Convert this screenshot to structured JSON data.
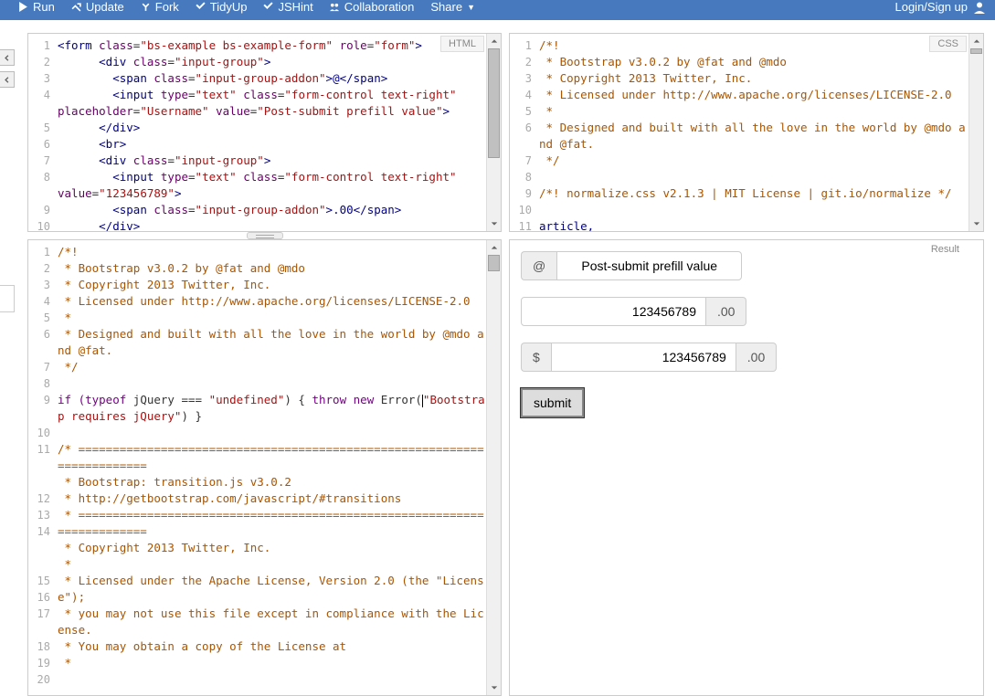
{
  "topbar": {
    "run": "Run",
    "update": "Update",
    "fork": "Fork",
    "tidyup": "TidyUp",
    "jshint": "JSHint",
    "collaboration": "Collaboration",
    "share": "Share",
    "login": "Login/Sign up"
  },
  "panels": {
    "html_label": "HTML",
    "css_label": "CSS",
    "result_label": "Result"
  },
  "html_gutter": [
    "1",
    "2",
    "3",
    "4",
    "5",
    "6",
    "7",
    "8",
    "9",
    "10"
  ],
  "css_gutter": [
    "1",
    "2",
    "3",
    "4",
    "5",
    "6",
    "7",
    "8",
    "9",
    "10",
    "11"
  ],
  "js_gutter": [
    "1",
    "2",
    "3",
    "4",
    "5",
    "6",
    "7",
    "8",
    "9",
    "10",
    "11",
    "12",
    "13",
    "14",
    "15",
    "16",
    "17",
    "18",
    "19",
    "20"
  ],
  "html_code": {
    "l1": {
      "a": "<form ",
      "b": "class",
      "c": "=",
      "d": "\"bs-example bs-example-form\"",
      "e": " role",
      "f": "=",
      "g": "\"form\"",
      "h": ">"
    },
    "l2": {
      "a": "      <div ",
      "b": "class",
      "c": "=",
      "d": "\"input-group\"",
      "e": ">"
    },
    "l3": {
      "a": "        <span ",
      "b": "class",
      "c": "=",
      "d": "\"input-group-addon\"",
      "e": ">@</span>"
    },
    "l4": {
      "a": "        <input ",
      "b": "type",
      "c": "=",
      "d": "\"text\"",
      "e": " class",
      "f": "=",
      "g": "\"form-control text-right\""
    },
    "l4b": {
      "a": "placeholder",
      "b": "=",
      "c": "\"Username\"",
      "d": " value",
      "e": "=",
      "f": "\"Post-submit prefill value\"",
      "g": ">"
    },
    "l5": {
      "a": "      </div>"
    },
    "l6": {
      "a": "      <br>"
    },
    "l7": {
      "a": "      <div ",
      "b": "class",
      "c": "=",
      "d": "\"input-group\"",
      "e": ">"
    },
    "l8": {
      "a": "        <input ",
      "b": "type",
      "c": "=",
      "d": "\"text\"",
      "e": " class",
      "f": "=",
      "g": "\"form-control text-right\""
    },
    "l8b": {
      "a": "value",
      "b": "=",
      "c": "\"123456789\"",
      "d": ">"
    },
    "l9": {
      "a": "        <span ",
      "b": "class",
      "c": "=",
      "d": "\"input-group-addon\"",
      "e": ">.00</span>"
    },
    "l10": {
      "a": "      </div>"
    }
  },
  "css_code": {
    "l1": "/*!",
    "l2": " * Bootstrap v3.0.2 by @fat and @mdo",
    "l3": " * Copyright 2013 Twitter, Inc.",
    "l4": " * Licensed under http://www.apache.org/licenses/LICENSE-2.0",
    "l5": " *",
    "l6": " * Designed and built with all the love in the world by @mdo and @fat.",
    "l7": " */",
    "l8": "",
    "l9": "/*! normalize.css v2.1.3 | MIT License | git.io/normalize */",
    "l10": "",
    "l11": "article,"
  },
  "js_code": {
    "l1": "/*!",
    "l2": " * Bootstrap v3.0.2 by @fat and @mdo",
    "l3": " * Copyright 2013 Twitter, Inc.",
    "l4": " * Licensed under http://www.apache.org/licenses/LICENSE-2.0",
    "l5": " *",
    "l6": " * Designed and built with all the love in the world by @mdo and @fat.",
    "l7": " */",
    "l8": "",
    "l9a": "if (",
    "l9b": "typeof",
    "l9c": " jQuery === ",
    "l9d": "\"undefined\"",
    "l9e": ") { ",
    "l9f": "throw",
    "l9g": " ",
    "l9h": "new",
    "l9i": " Error(",
    "l9j": "\"Bootstrap requires jQuery\"",
    "l9k": ") }",
    "l10": "",
    "l11a": "/* ",
    "l11b": "========================================================================",
    "l12": " * Bootstrap: transition.js v3.0.2",
    "l13": " * http://getbootstrap.com/javascript/#transitions",
    "l14": " * ",
    "l14b": "========================================================================",
    "l15": " * Copyright 2013 Twitter, Inc.",
    "l16": " *",
    "l17": " * Licensed under the Apache License, Version 2.0 (the \"License\");",
    "l18": " * you may not use this file except in compliance with the License.",
    "l19": " * You may obtain a copy of the License at",
    "l20": " *"
  },
  "result": {
    "at": "@",
    "input1": "Post-submit prefill value",
    "input2": "123456789",
    "dot00": ".00",
    "dollar": "$",
    "input3": "123456789",
    "submit": "submit"
  }
}
